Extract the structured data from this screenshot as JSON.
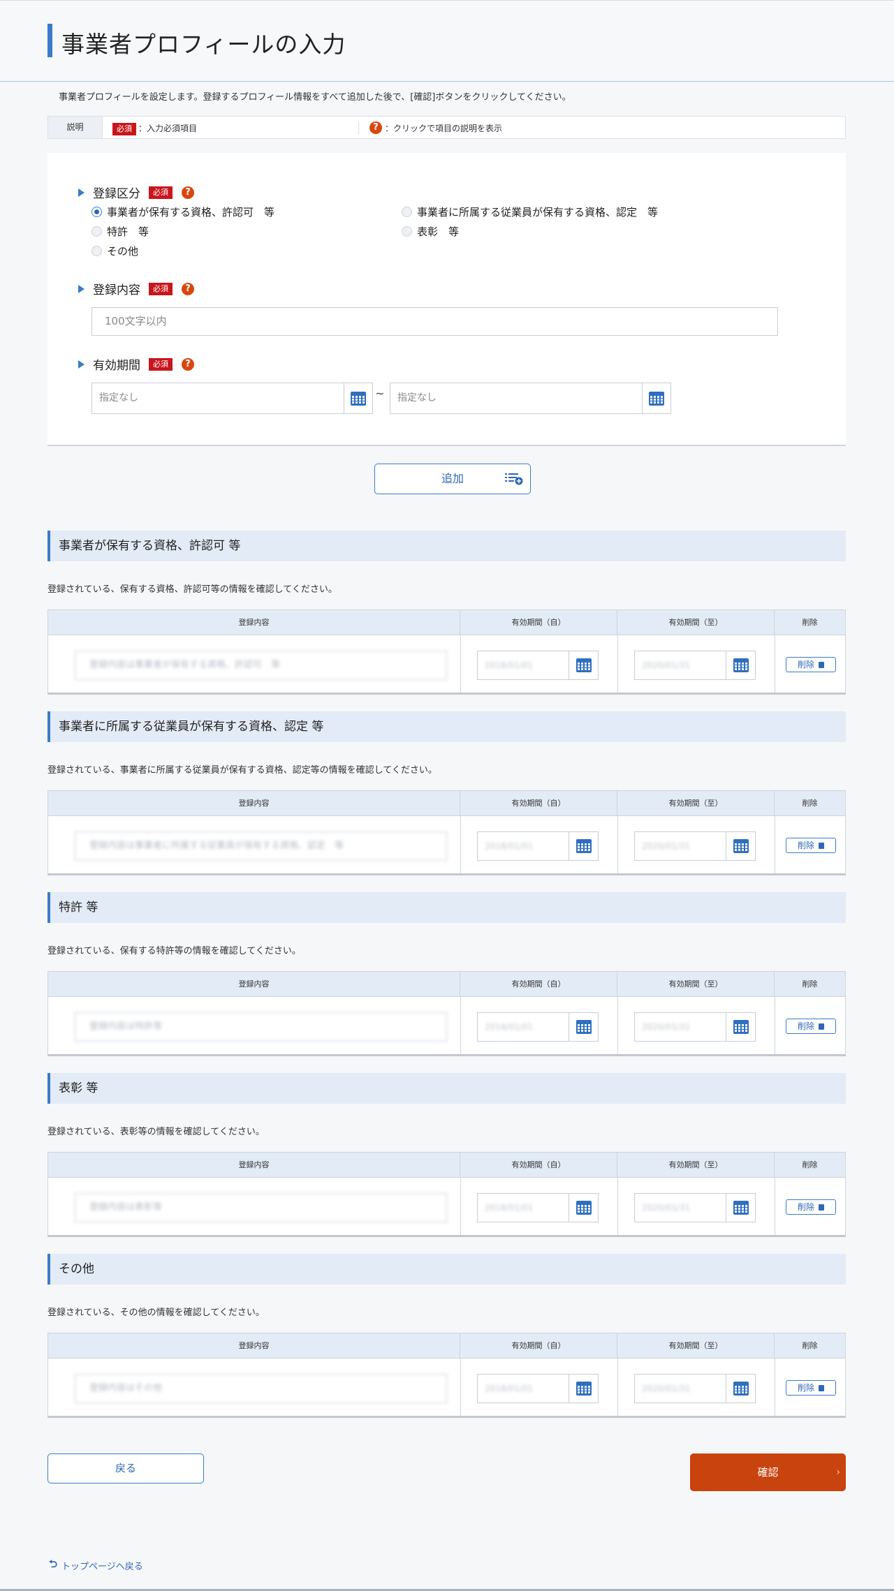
{
  "header": {
    "title": "事業者プロフィールの入力"
  },
  "intro": "事業者プロフィールを設定します。登録するプロフィール情報をすべて追加した後で、[確認]ボタンをクリックしてください。",
  "legend": {
    "label": "説明",
    "required_badge": "必須",
    "required_text": "：入力必須項目",
    "help_symbol": "?",
    "help_text": "：クリックで項目の説明を表示"
  },
  "form": {
    "category": {
      "label": "登録区分",
      "badge": "必須",
      "options": [
        "事業者が保有する資格、許認可　等",
        "事業者に所属する従業員が保有する資格、認定　等",
        "特許　等",
        "表彰　等",
        "その他"
      ],
      "selected": "事業者が保有する資格、許認可　等"
    },
    "content": {
      "label": "登録内容",
      "badge": "必須",
      "placeholder": "100文字以内"
    },
    "period": {
      "label": "有効期間",
      "badge": "必須",
      "from_placeholder": "指定なし",
      "to_placeholder": "指定なし",
      "separator": "~"
    }
  },
  "add_button": "追加",
  "table_headers": {
    "content": "登録内容",
    "from": "有効期間（自）",
    "to": "有効期間（至）",
    "delete": "削除"
  },
  "delete_label": "削除",
  "sections": [
    {
      "title": "事業者が保有する資格、許認可 等",
      "description": "登録されている、保有する資格、許認可等の情報を確認してください。",
      "row": {
        "content": "登録内容は事業者が保有する資格、許認可　等",
        "from": "2018/01/01",
        "to": "2020/01/31"
      }
    },
    {
      "title": "事業者に所属する従業員が保有する資格、認定 等",
      "description": "登録されている、事業者に所属する従業員が保有する資格、認定等の情報を確認してください。",
      "row": {
        "content": "登録内容は事業者に所属する従業員が保有する資格、認定　等",
        "from": "2018/01/01",
        "to": "2020/01/31"
      }
    },
    {
      "title": "特許 等",
      "description": "登録されている、保有する特許等の情報を確認してください。",
      "row": {
        "content": "登録内容は特許等",
        "from": "2018/01/01",
        "to": "2020/01/31"
      }
    },
    {
      "title": "表彰 等",
      "description": "登録されている、表彰等の情報を確認してください。",
      "row": {
        "content": "登録内容は表彰等",
        "from": "2018/01/01",
        "to": "2020/01/31"
      }
    },
    {
      "title": "その他",
      "description": "登録されている、その他の情報を確認してください。",
      "row": {
        "content": "登録内容はその他",
        "from": "2018/01/01",
        "to": "2020/01/31"
      }
    }
  ],
  "back_button": "戻る",
  "confirm_button": "確認",
  "confirm_chevron": "›",
  "top_link": "トップページへ戻る",
  "colors": {
    "accent": "#3a7cc8",
    "required": "#c8161d",
    "help": "#d9470f",
    "confirm": "#c9430f"
  }
}
